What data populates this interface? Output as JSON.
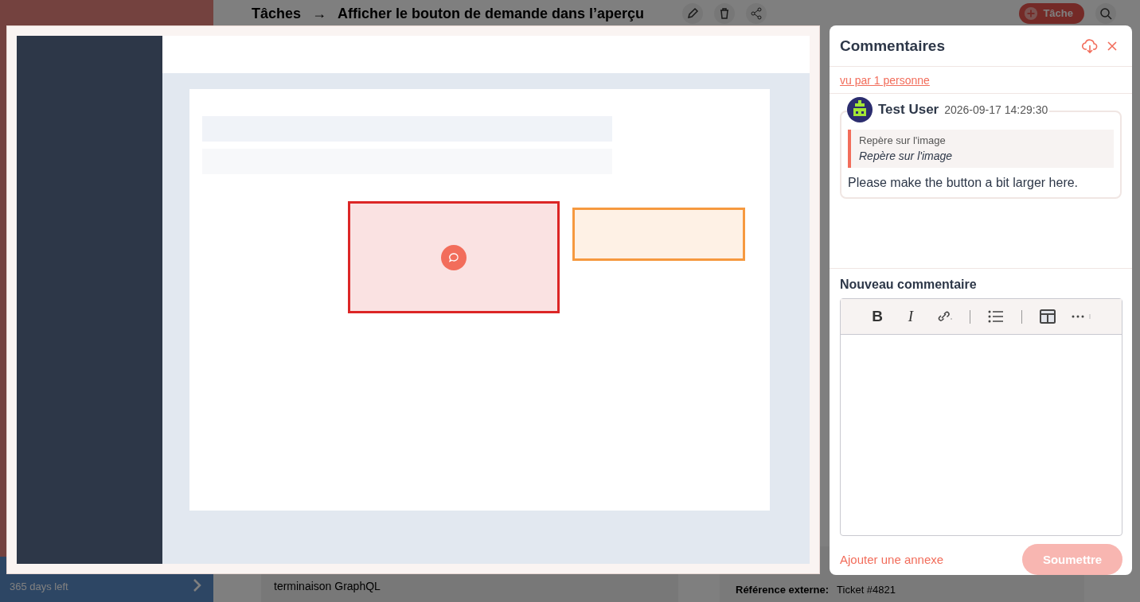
{
  "app": {
    "breadcrumb_root": "Tâches",
    "breadcrumb_separator": "→",
    "task_title": "Afficher le bouton de demande dans l’aperçu",
    "new_task_button": "Tâche"
  },
  "sidebar_footer": {
    "subtitle": "365 days left"
  },
  "background": {
    "row_text": "terminaison GraphQL",
    "fields": [
      {
        "label": "Référence externe:",
        "value": "Ticket #4821"
      }
    ]
  },
  "image_viewer": {
    "annotations": [
      {
        "color": "#dc2626",
        "has_comment": true
      },
      {
        "color": "#f6993f",
        "has_comment": false
      }
    ]
  },
  "comments_panel": {
    "title": "Commentaires",
    "seen_by": "vu par 1 personne",
    "comments": [
      {
        "author": "Test User",
        "timestamp": "2026-09-17 14:29:30",
        "quote_label": "Repère sur l'image",
        "quote_text": "Repère sur l'image",
        "body": "Please make the button a bit larger here."
      }
    ],
    "new_comment": {
      "label": "Nouveau commentaire",
      "toolbar": [
        {
          "kind": "bold",
          "label": "B"
        },
        {
          "kind": "italic",
          "label": "I"
        },
        {
          "kind": "link"
        },
        {
          "kind": "divider"
        },
        {
          "kind": "list"
        },
        {
          "kind": "divider"
        },
        {
          "kind": "table"
        },
        {
          "kind": "more"
        }
      ]
    },
    "attach_link": "Ajouter une annexe",
    "submit": {
      "label": "Soumettre",
      "disabled": true
    }
  }
}
